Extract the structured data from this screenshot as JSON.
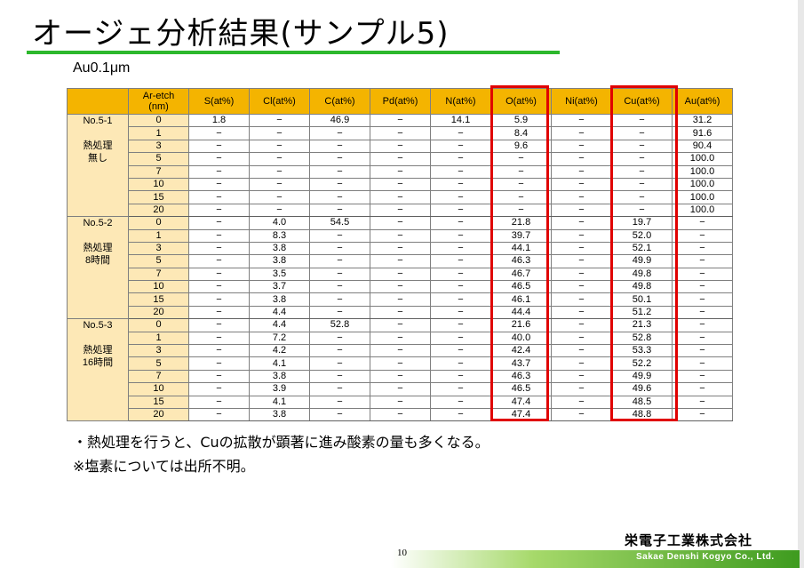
{
  "title": "オージェ分析結果(サンプル5)",
  "subtitle": "Au0.1μm",
  "headers": [
    "",
    "Ar-etch\n(nm)",
    "S(at%)",
    "Cl(at%)",
    "C(at%)",
    "Pd(at%)",
    "N(at%)",
    "O(at%)",
    "Ni(at%)",
    "Cu(at%)",
    "Au(at%)"
  ],
  "groups": [
    {
      "id": "No.5-1",
      "treatment_line1": "熱処理",
      "treatment_line2": "無し",
      "rows": [
        [
          "0",
          "1.8",
          "−",
          "46.9",
          "−",
          "14.1",
          "5.9",
          "−",
          "−",
          "31.2"
        ],
        [
          "1",
          "−",
          "−",
          "−",
          "−",
          "−",
          "8.4",
          "−",
          "−",
          "91.6"
        ],
        [
          "3",
          "−",
          "−",
          "−",
          "−",
          "−",
          "9.6",
          "−",
          "−",
          "90.4"
        ],
        [
          "5",
          "−",
          "−",
          "−",
          "−",
          "−",
          "−",
          "−",
          "−",
          "100.0"
        ],
        [
          "7",
          "−",
          "−",
          "−",
          "−",
          "−",
          "−",
          "−",
          "−",
          "100.0"
        ],
        [
          "10",
          "−",
          "−",
          "−",
          "−",
          "−",
          "−",
          "−",
          "−",
          "100.0"
        ],
        [
          "15",
          "−",
          "−",
          "−",
          "−",
          "−",
          "−",
          "−",
          "−",
          "100.0"
        ],
        [
          "20",
          "−",
          "−",
          "−",
          "−",
          "−",
          "−",
          "−",
          "−",
          "100.0"
        ]
      ]
    },
    {
      "id": "No.5-2",
      "treatment_line1": "熱処理",
      "treatment_line2": "8時間",
      "rows": [
        [
          "0",
          "−",
          "4.0",
          "54.5",
          "−",
          "−",
          "21.8",
          "−",
          "19.7",
          "−"
        ],
        [
          "1",
          "−",
          "8.3",
          "−",
          "−",
          "−",
          "39.7",
          "−",
          "52.0",
          "−"
        ],
        [
          "3",
          "−",
          "3.8",
          "−",
          "−",
          "−",
          "44.1",
          "−",
          "52.1",
          "−"
        ],
        [
          "5",
          "−",
          "3.8",
          "−",
          "−",
          "−",
          "46.3",
          "−",
          "49.9",
          "−"
        ],
        [
          "7",
          "−",
          "3.5",
          "−",
          "−",
          "−",
          "46.7",
          "−",
          "49.8",
          "−"
        ],
        [
          "10",
          "−",
          "3.7",
          "−",
          "−",
          "−",
          "46.5",
          "−",
          "49.8",
          "−"
        ],
        [
          "15",
          "−",
          "3.8",
          "−",
          "−",
          "−",
          "46.1",
          "−",
          "50.1",
          "−"
        ],
        [
          "20",
          "−",
          "4.4",
          "−",
          "−",
          "−",
          "44.4",
          "−",
          "51.2",
          "−"
        ]
      ]
    },
    {
      "id": "No.5-3",
      "treatment_line1": "熱処理",
      "treatment_line2": "16時間",
      "rows": [
        [
          "0",
          "−",
          "4.4",
          "52.8",
          "−",
          "−",
          "21.6",
          "−",
          "21.3",
          "−"
        ],
        [
          "1",
          "−",
          "7.2",
          "−",
          "−",
          "−",
          "40.0",
          "−",
          "52.8",
          "−"
        ],
        [
          "3",
          "−",
          "4.2",
          "−",
          "−",
          "−",
          "42.4",
          "−",
          "53.3",
          "−"
        ],
        [
          "5",
          "−",
          "4.1",
          "−",
          "−",
          "−",
          "43.7",
          "−",
          "52.2",
          "−"
        ],
        [
          "7",
          "−",
          "3.8",
          "−",
          "−",
          "−",
          "46.3",
          "−",
          "49.9",
          "−"
        ],
        [
          "10",
          "−",
          "3.9",
          "−",
          "−",
          "−",
          "46.5",
          "−",
          "49.6",
          "−"
        ],
        [
          "15",
          "−",
          "4.1",
          "−",
          "−",
          "−",
          "47.4",
          "−",
          "48.5",
          "−"
        ],
        [
          "20",
          "−",
          "3.8",
          "−",
          "−",
          "−",
          "47.4",
          "−",
          "48.8",
          "−"
        ]
      ]
    }
  ],
  "notes": [
    "・熱処理を行うと、Cuの拡散が顕著に進み酸素の量も多くなる。",
    "※塩素については出所不明。"
  ],
  "page_number": "10",
  "company_jp": "栄電子工業株式会社",
  "company_en": "Sakae Denshi Kogyo Co., Ltd.",
  "colors": {
    "header": "#f4b400",
    "sample_cells": "#fde8b6",
    "highlight": "#e00000",
    "accent": "#2db82d"
  }
}
